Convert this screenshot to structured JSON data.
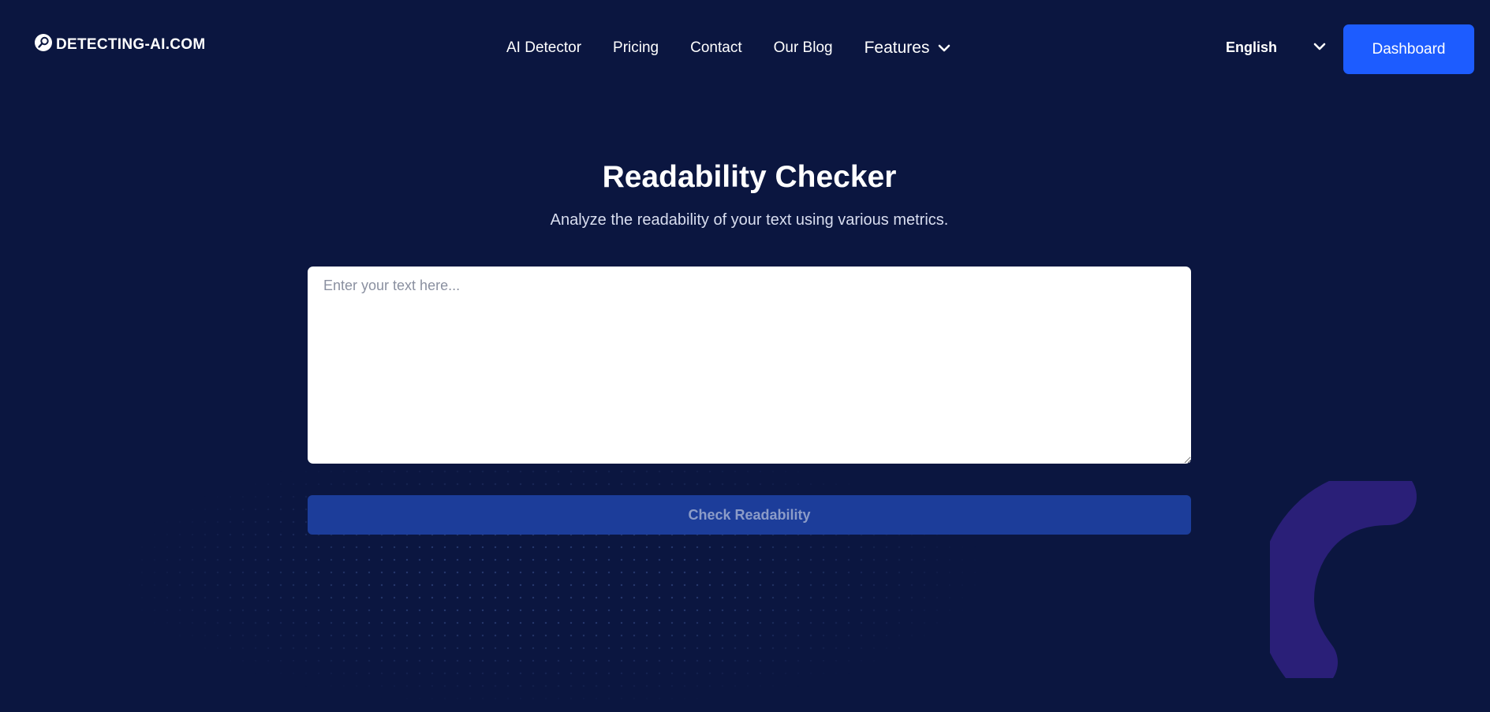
{
  "brand": {
    "name": "DETECTING-AI.COM",
    "icon": "magnifier-logo-icon"
  },
  "nav": {
    "items": [
      {
        "label": "AI Detector"
      },
      {
        "label": "Pricing"
      },
      {
        "label": "Contact"
      },
      {
        "label": "Our Blog"
      }
    ],
    "features_label": "Features"
  },
  "language": {
    "selected": "English"
  },
  "header": {
    "dashboard_label": "Dashboard"
  },
  "main": {
    "title": "Readability Checker",
    "subtitle": "Analyze the readability of your text using various metrics.",
    "input": {
      "placeholder": "Enter your text here...",
      "value": ""
    },
    "submit_label": "Check Readability"
  },
  "colors": {
    "background": "#0b1640",
    "accent": "#1d5cff",
    "submit_disabled": "#1c3d9a",
    "decor_arc": "#2a1f78"
  }
}
